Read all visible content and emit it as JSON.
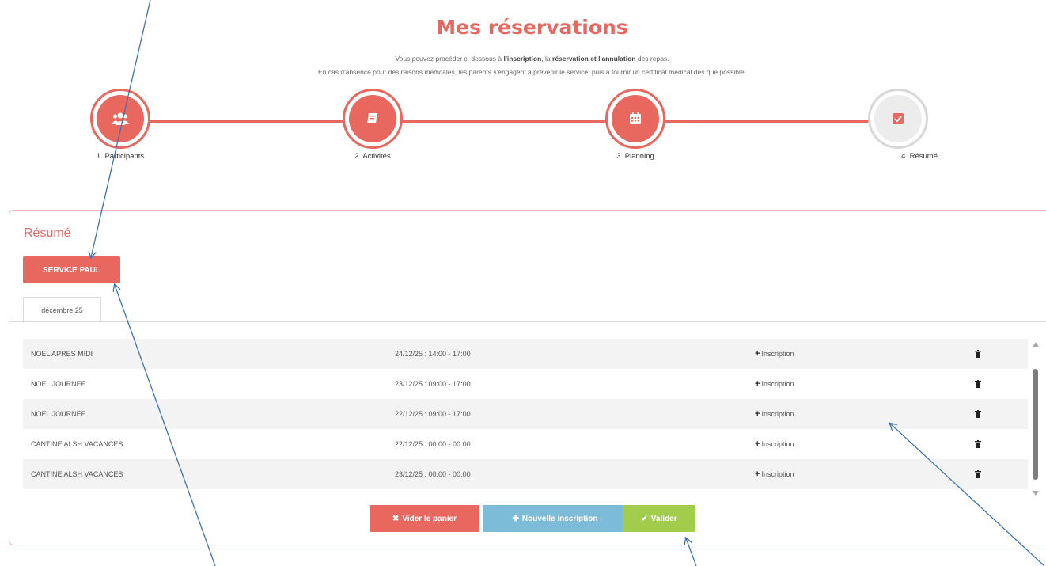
{
  "page": {
    "title": "Mes réservations",
    "intro_line1_a": "Vous pouvez procéder ci-dessous à ",
    "intro_line1_b": "l'inscription",
    "intro_line1_c": ", la ",
    "intro_line1_d": "réservation et l'annulation",
    "intro_line1_e": " des repas.",
    "intro_line2": "En cas d'absence pour des raisons médicales, les parents s'engagent à prévenir le service, puis à fournir un certificat médical dès que possible."
  },
  "steps": [
    {
      "label": "1. Participants",
      "icon": "users-icon",
      "state": "active"
    },
    {
      "label": "2. Activités",
      "icon": "book-icon",
      "state": "active"
    },
    {
      "label": "3. Planning",
      "icon": "calendar-icon",
      "state": "active"
    },
    {
      "label": "4. Résumé",
      "icon": "check-square-icon",
      "state": "current"
    }
  ],
  "summary": {
    "title": "Résumé",
    "service_button": "SERVICE PAUL",
    "tab_label": "décembre 25",
    "rows": [
      {
        "activity": "NOEL APRES MIDI",
        "slot": "24/12/25 : 14:00 - 17:00",
        "action": "Inscription"
      },
      {
        "activity": "NOEL JOURNEE",
        "slot": "23/12/25 : 09:00 - 17:00",
        "action": "Inscription"
      },
      {
        "activity": "NOEL JOURNEE",
        "slot": "22/12/25 : 09:00 - 17:00",
        "action": "Inscription"
      },
      {
        "activity": "CANTINE ALSH VACANCES",
        "slot": "22/12/25 : 00:00 - 00:00",
        "action": "Inscription"
      },
      {
        "activity": "CANTINE ALSH VACANCES",
        "slot": "23/12/25 : 00:00 - 00:00",
        "action": "Inscription"
      }
    ]
  },
  "actions": {
    "empty_cart": "Vider le panier",
    "new_registration": "Nouvelle inscription",
    "validate": "Valider"
  },
  "colors": {
    "accent": "#e8685f",
    "info": "#7dbcd8",
    "success": "#a2cc4c",
    "annotation": "#3c72b4"
  }
}
